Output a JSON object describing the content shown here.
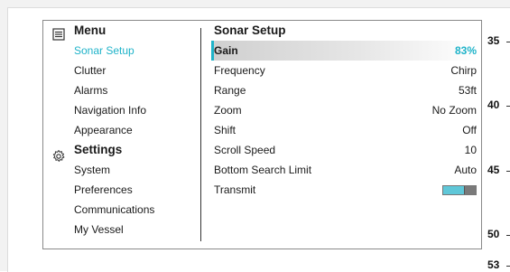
{
  "left_menu": {
    "menu_header": "Menu",
    "menu_items": [
      "Sonar Setup",
      "Clutter",
      "Alarms",
      "Navigation Info",
      "Appearance"
    ],
    "settings_header": "Settings",
    "settings_items": [
      "System",
      "Preferences",
      "Communications",
      "My Vessel"
    ]
  },
  "right_panel": {
    "title": "Sonar Setup",
    "rows": [
      {
        "label": "Gain",
        "value": "83%"
      },
      {
        "label": "Frequency",
        "value": "Chirp"
      },
      {
        "label": "Range",
        "value": "53ft"
      },
      {
        "label": "Zoom",
        "value": "No Zoom"
      },
      {
        "label": "Shift",
        "value": "Off"
      },
      {
        "label": "Scroll Speed",
        "value": "10"
      },
      {
        "label": "Bottom Search Limit",
        "value": "Auto"
      },
      {
        "label": "Transmit",
        "value": ""
      }
    ]
  },
  "depth_scale": {
    "labels": [
      "35",
      "40",
      "45",
      "50",
      "53"
    ]
  },
  "colors": {
    "accent": "#1fb3c9",
    "toggle_on": "#5fc7d8"
  },
  "icons": [
    "menu-list-icon",
    "gear-icon"
  ]
}
